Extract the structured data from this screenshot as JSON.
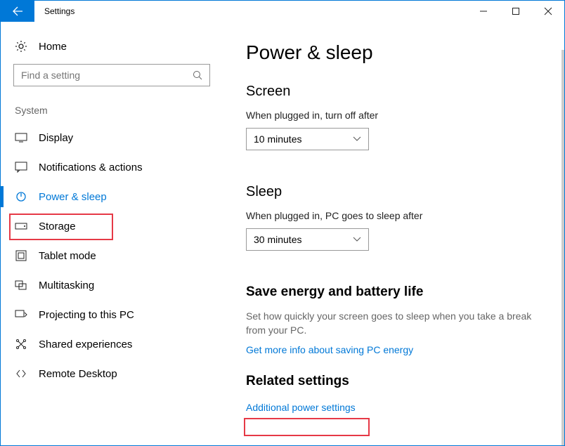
{
  "titlebar": {
    "title": "Settings"
  },
  "sidebar": {
    "home": "Home",
    "search_placeholder": "Find a setting",
    "group": "System",
    "items": [
      {
        "label": "Display"
      },
      {
        "label": "Notifications & actions"
      },
      {
        "label": "Power & sleep"
      },
      {
        "label": "Storage"
      },
      {
        "label": "Tablet mode"
      },
      {
        "label": "Multitasking"
      },
      {
        "label": "Projecting to this PC"
      },
      {
        "label": "Shared experiences"
      },
      {
        "label": "Remote Desktop"
      }
    ]
  },
  "main": {
    "heading": "Power & sleep",
    "screen": {
      "title": "Screen",
      "label": "When plugged in, turn off after",
      "value": "10 minutes"
    },
    "sleep": {
      "title": "Sleep",
      "label": "When plugged in, PC goes to sleep after",
      "value": "30 minutes"
    },
    "save_energy": {
      "title": "Save energy and battery life",
      "desc": "Set how quickly your screen goes to sleep when you take a break from your PC.",
      "link": "Get more info about saving PC energy"
    },
    "related": {
      "title": "Related settings",
      "link": "Additional power settings"
    }
  }
}
